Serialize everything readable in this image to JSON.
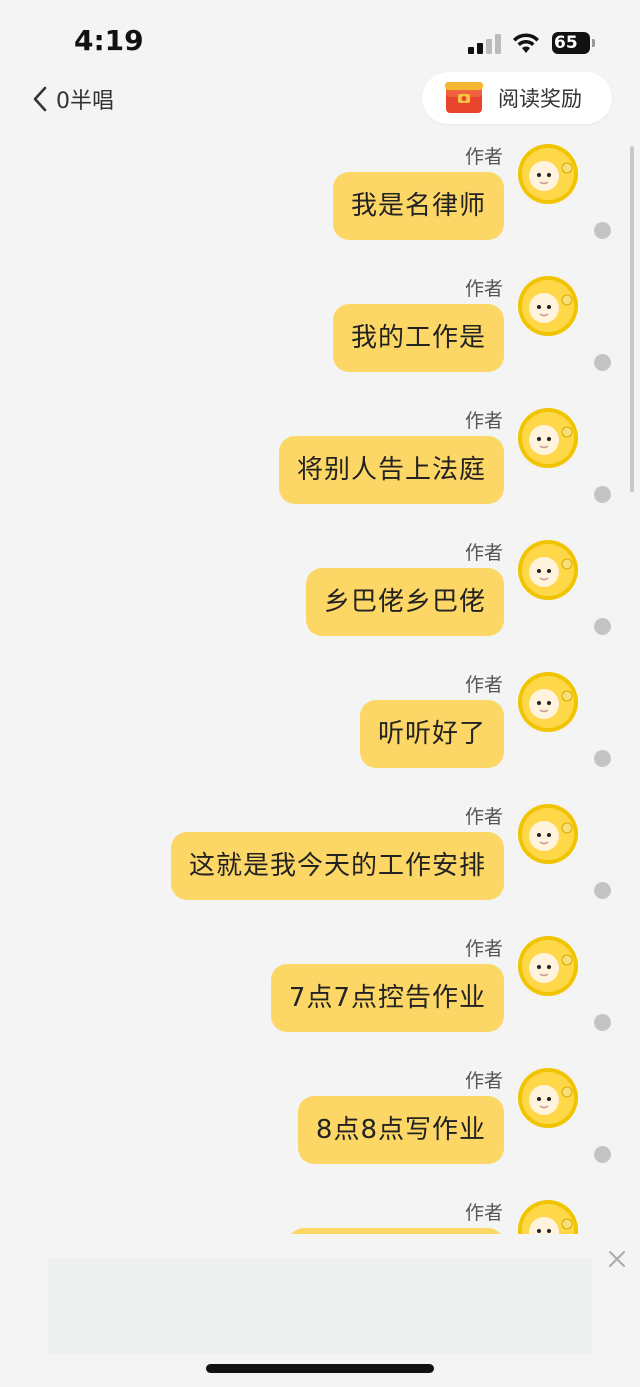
{
  "status": {
    "time": "4:19",
    "battery": "65"
  },
  "nav": {
    "back_title": "0半唱",
    "reward_label": "阅读奖励"
  },
  "messages": [
    {
      "author": "作者",
      "text": "我是名律师"
    },
    {
      "author": "作者",
      "text": "我的工作是"
    },
    {
      "author": "作者",
      "text": "将别人告上法庭"
    },
    {
      "author": "作者",
      "text": "乡巴佬乡巴佬"
    },
    {
      "author": "作者",
      "text": "听听好了"
    },
    {
      "author": "作者",
      "text": "这就是我今天的工作安排"
    },
    {
      "author": "作者",
      "text": "7点7点控告作业"
    },
    {
      "author": "作者",
      "text": "8点8点写作业"
    },
    {
      "author": "作者",
      "text": ""
    }
  ],
  "colors": {
    "bubble": "#fdd766",
    "background": "#f4f4f4",
    "avatar": "#f2c400"
  },
  "icons": {
    "back": "chevron-left-icon",
    "reward": "red-envelope-icon",
    "close": "close-icon",
    "avatar": "yellow-character-avatar"
  }
}
